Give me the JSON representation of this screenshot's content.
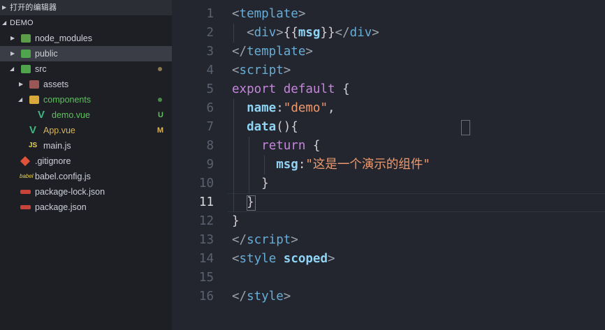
{
  "sidebar": {
    "open_editors_label": "打开的编辑器",
    "project_label": "DEMO",
    "items": [
      {
        "label": "node_modules",
        "icon": "node-modules-folder-icon",
        "color": "#cdd0d6"
      },
      {
        "label": "public",
        "icon": "public-folder-icon",
        "color": "#cdd0d6"
      },
      {
        "label": "src",
        "icon": "src-folder-icon",
        "color": "#cdd0d6"
      },
      {
        "label": "assets",
        "icon": "assets-folder-icon",
        "color": "#cdd0d6"
      },
      {
        "label": "components",
        "icon": "components-folder-icon",
        "color": "#5fc15e"
      },
      {
        "label": "demo.vue",
        "icon": "vue-file-icon",
        "color": "#5fc15e",
        "badge": "U"
      },
      {
        "label": "App.vue",
        "icon": "vue-file-icon",
        "color": "#d8b45b",
        "badge": "M"
      },
      {
        "label": "main.js",
        "icon": "js-file-icon",
        "color": "#cdd0d6"
      },
      {
        "label": ".gitignore",
        "icon": "git-file-icon",
        "color": "#cdd0d6"
      },
      {
        "label": "babel.config.js",
        "icon": "babel-file-icon",
        "color": "#cdd0d6"
      },
      {
        "label": "package-lock.json",
        "icon": "npm-file-icon",
        "color": "#cdd0d6"
      },
      {
        "label": "package.json",
        "icon": "npm-file-icon",
        "color": "#cdd0d6"
      }
    ]
  },
  "editor": {
    "active_line": 11,
    "lines": [
      {
        "n": "1",
        "tokens": [
          [
            "t-punct",
            "<"
          ],
          [
            "t-tag",
            "template"
          ],
          [
            "t-punct",
            ">"
          ]
        ]
      },
      {
        "n": "2",
        "tokens": [
          [
            "t-plain",
            "  "
          ],
          [
            "t-punct",
            "<"
          ],
          [
            "t-tag",
            "div"
          ],
          [
            "t-punct",
            ">"
          ],
          [
            "t-brace",
            "{{"
          ],
          [
            "t-prop",
            "msg"
          ],
          [
            "t-brace",
            "}}"
          ],
          [
            "t-punct",
            "</"
          ],
          [
            "t-tag",
            "div"
          ],
          [
            "t-punct",
            ">"
          ]
        ]
      },
      {
        "n": "3",
        "tokens": [
          [
            "t-punct",
            "</"
          ],
          [
            "t-tag",
            "template"
          ],
          [
            "t-punct",
            ">"
          ]
        ]
      },
      {
        "n": "4",
        "tokens": [
          [
            "t-punct",
            "<"
          ],
          [
            "t-tag",
            "script"
          ],
          [
            "t-punct",
            ">"
          ]
        ]
      },
      {
        "n": "5",
        "tokens": [
          [
            "t-kw",
            "export"
          ],
          [
            "t-plain",
            " "
          ],
          [
            "t-kw",
            "default"
          ],
          [
            "t-plain",
            " {"
          ]
        ]
      },
      {
        "n": "6",
        "tokens": [
          [
            "t-plain",
            "  "
          ],
          [
            "t-prop",
            "name"
          ],
          [
            "t-plain",
            ":"
          ],
          [
            "t-str",
            "\"demo\""
          ],
          [
            "t-plain",
            ","
          ]
        ]
      },
      {
        "n": "7",
        "tokens": [
          [
            "t-plain",
            "  "
          ],
          [
            "t-prop",
            "data"
          ],
          [
            "t-plain",
            "(){"
          ]
        ]
      },
      {
        "n": "8",
        "tokens": [
          [
            "t-plain",
            "    "
          ],
          [
            "t-kw",
            "return"
          ],
          [
            "t-plain",
            " {"
          ]
        ]
      },
      {
        "n": "9",
        "tokens": [
          [
            "t-plain",
            "      "
          ],
          [
            "t-prop",
            "msg"
          ],
          [
            "t-plain",
            ":"
          ],
          [
            "t-str",
            "\"这是一个演示的组件\""
          ]
        ]
      },
      {
        "n": "10",
        "tokens": [
          [
            "t-plain",
            "    }"
          ]
        ]
      },
      {
        "n": "11",
        "tokens": [
          [
            "t-plain",
            "  }"
          ]
        ]
      },
      {
        "n": "12",
        "tokens": [
          [
            "t-plain",
            "}"
          ]
        ]
      },
      {
        "n": "13",
        "tokens": [
          [
            "t-punct",
            "</"
          ],
          [
            "t-tag",
            "script"
          ],
          [
            "t-punct",
            ">"
          ]
        ]
      },
      {
        "n": "14",
        "tokens": [
          [
            "t-punct",
            "<"
          ],
          [
            "t-tag",
            "style"
          ],
          [
            "t-plain",
            " "
          ],
          [
            "t-prop",
            "scoped"
          ],
          [
            "t-punct",
            ">"
          ]
        ]
      },
      {
        "n": "15",
        "tokens": []
      },
      {
        "n": "16",
        "tokens": [
          [
            "t-punct",
            "</"
          ],
          [
            "t-tag",
            "style"
          ],
          [
            "t-punct",
            ">"
          ]
        ]
      }
    ]
  }
}
